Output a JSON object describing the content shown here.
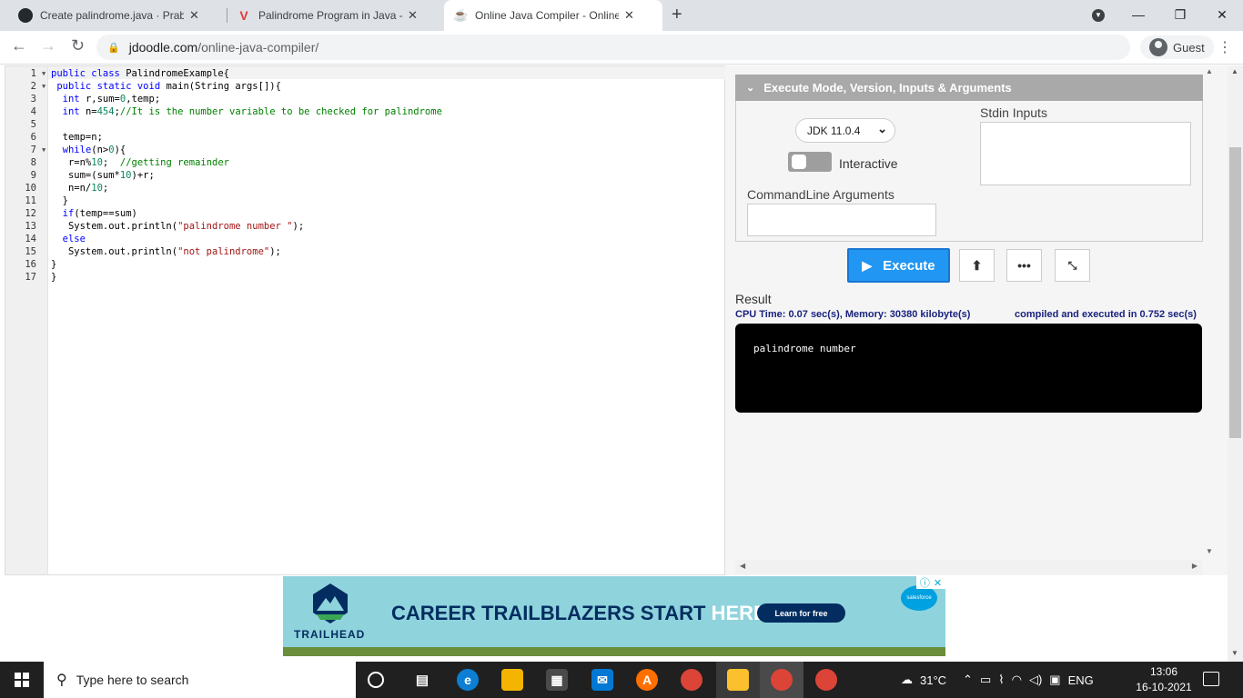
{
  "tabs": [
    {
      "title": "Create palindrome.java · Prabhak",
      "icon": "github-icon"
    },
    {
      "title": "Palindrome Program in Java - Jav",
      "icon": "javatpoint-icon"
    },
    {
      "title": "Online Java Compiler - Online Jav",
      "icon": "jdoodle-icon"
    }
  ],
  "window_controls": {
    "minimize": "—",
    "restore": "❐",
    "close": "✕"
  },
  "address": {
    "host": "jdoodle.com",
    "path": "/online-java-compiler/"
  },
  "profile": {
    "label": "Guest"
  },
  "editor": {
    "line_numbers": [
      "1",
      "2",
      "3",
      "4",
      "5",
      "6",
      "7",
      "8",
      "9",
      "10",
      "11",
      "12",
      "13",
      "14",
      "15",
      "16",
      "17"
    ],
    "lines": [
      "public class PalindromeExample{",
      " public static void main(String args[]){",
      "  int r,sum=0,temp;",
      "  int n=454;//It is the number variable to be checked for palindrome",
      "",
      "  temp=n;",
      "  while(n>0){",
      "   r=n%10;  //getting remainder",
      "   sum=(sum*10)+r;",
      "   n=n/10;",
      "  }",
      "  if(temp==sum)",
      "   System.out.println(\"palindrome number \");",
      "  else",
      "   System.out.println(\"not palindrome\");",
      "}",
      "}"
    ]
  },
  "panel": {
    "header": "Execute Mode, Version, Inputs & Arguments",
    "jdk_version": "JDK 11.0.4",
    "interactive_label": "Interactive",
    "stdin_label": "Stdin Inputs",
    "cmdline_label": "CommandLine Arguments"
  },
  "execute": {
    "label": "Execute"
  },
  "result": {
    "label": "Result",
    "cpu": "CPU Time: 0.07 sec(s), Memory: 30380 kilobyte(s)",
    "compiled": "compiled and executed in 0.752 sec(s)",
    "output": "palindrome number"
  },
  "ad": {
    "brand": "TRAILHEAD",
    "headline_dark": "CAREER TRAILBLAZERS START ",
    "headline_light": "HERE.",
    "cta": "Learn for free",
    "sponsor": "salesforce"
  },
  "taskbar": {
    "search_placeholder": "Type here to search",
    "weather": "31°C",
    "language": "ENG",
    "time": "13:06",
    "date": "16-10-2021"
  }
}
